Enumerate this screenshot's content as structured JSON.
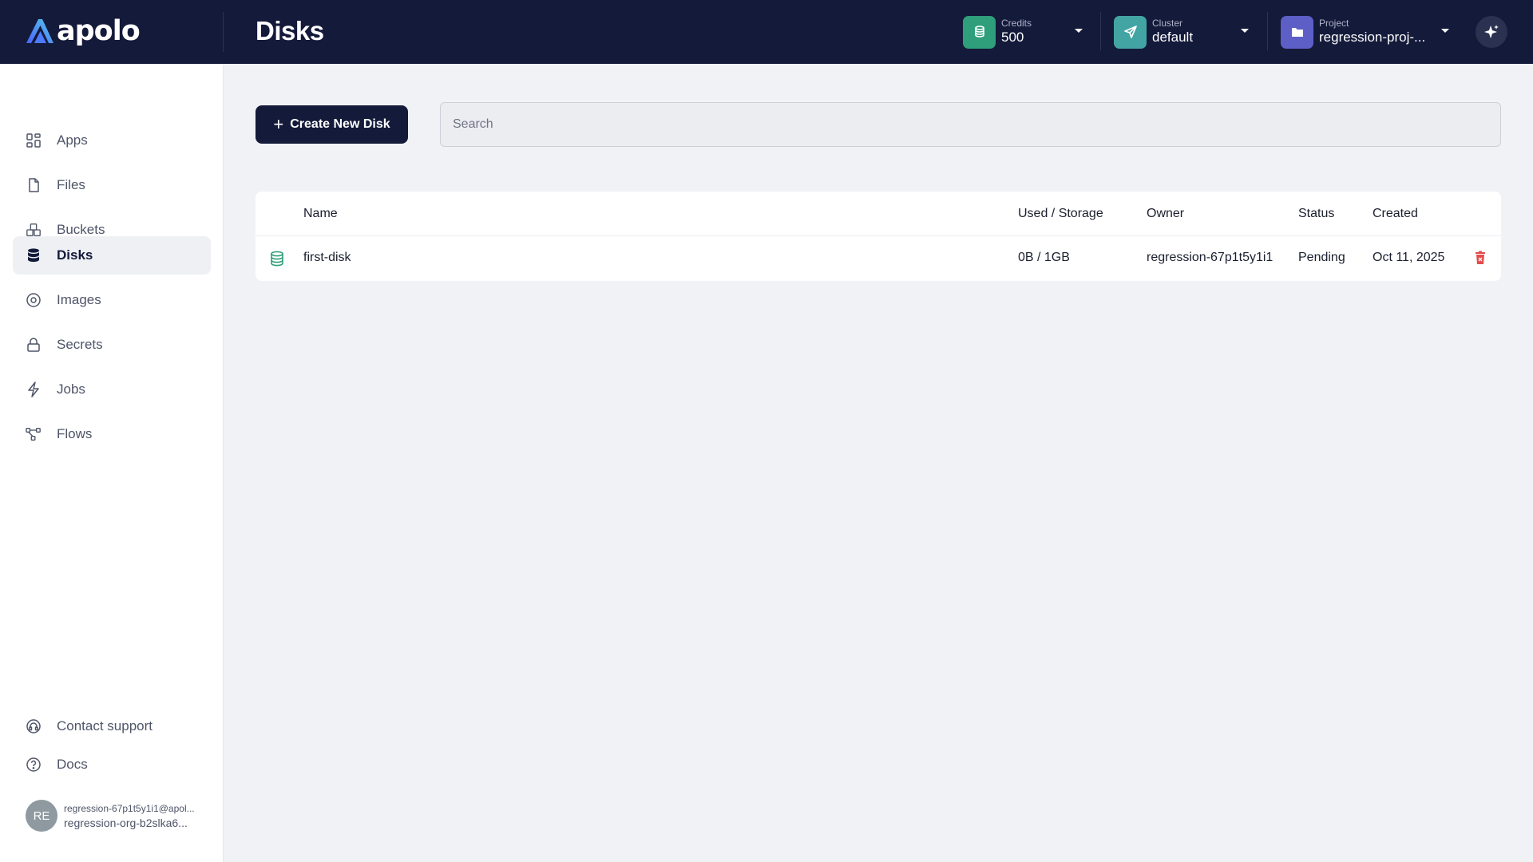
{
  "app": {
    "logo_text": "apolo",
    "page_title": "Disks"
  },
  "header": {
    "credits": {
      "label": "Credits",
      "value": "500",
      "color": "#2f9e7a"
    },
    "cluster": {
      "label": "Cluster",
      "value": "default",
      "color": "#43a5a3"
    },
    "project": {
      "label": "Project",
      "value": "regression-proj-...",
      "color": "#5d5fc7"
    }
  },
  "sidebar": {
    "items": [
      {
        "label": "Apps",
        "icon": "apps-grid-icon"
      },
      {
        "label": "Files",
        "icon": "file-icon"
      },
      {
        "label": "Buckets",
        "icon": "buckets-icon"
      },
      {
        "label": "Disks",
        "icon": "database-icon",
        "active": true
      },
      {
        "label": "Images",
        "icon": "image-disc-icon"
      },
      {
        "label": "Secrets",
        "icon": "lock-icon"
      },
      {
        "label": "Jobs",
        "icon": "lightning-icon"
      },
      {
        "label": "Flows",
        "icon": "flow-icon"
      }
    ],
    "bottom": [
      {
        "label": "Contact support",
        "icon": "headset-icon"
      },
      {
        "label": "Docs",
        "icon": "help-circle-icon"
      }
    ],
    "user": {
      "initials": "RE",
      "email": "regression-67p1t5y1i1@apol...",
      "org": "regression-org-b2slka6..."
    }
  },
  "toolbar": {
    "create_label": "Create New Disk",
    "search_placeholder": "Search"
  },
  "table": {
    "columns": [
      "Name",
      "Used / Storage",
      "Owner",
      "Status",
      "Created"
    ],
    "rows": [
      {
        "name": "first-disk",
        "usage": "0B / 1GB",
        "owner": "regression-67p1t5y1i1",
        "status": "Pending",
        "created": "Oct 11, 2025"
      }
    ]
  },
  "colors": {
    "accent_dark": "#141a3a",
    "disk_icon": "#2f9e7a",
    "delete": "#e34b4b"
  }
}
